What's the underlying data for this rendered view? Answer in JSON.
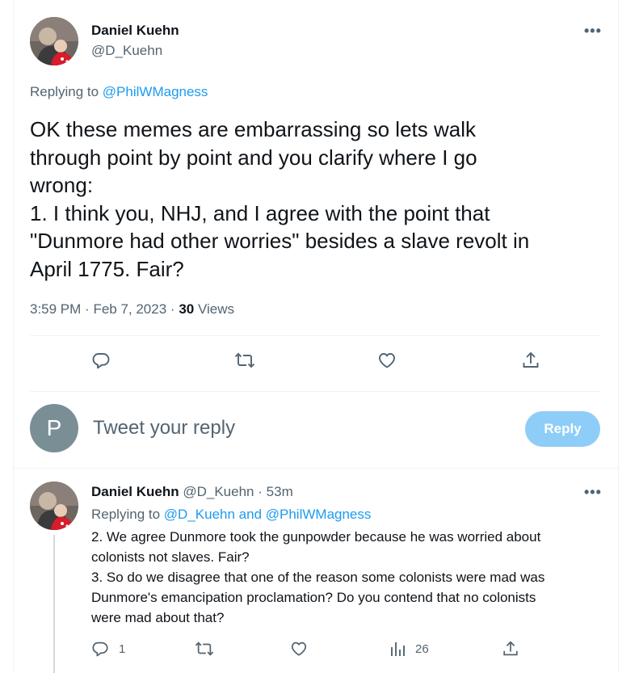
{
  "main_tweet": {
    "author_name": "Daniel Kuehn",
    "author_handle": "@D_Kuehn",
    "replying_prefix": "Replying to",
    "replying_to": "@PhilWMagness",
    "text": "OK these memes are embarrassing so lets walk\nthrough point by point and you clarify where I go\nwrong:\n1. I think you, NHJ, and I agree with the point that\n\"Dunmore had other worries\" besides a slave revolt in\nApril 1775. Fair?",
    "time": "3:59 PM",
    "date": "Feb 7, 2023",
    "views_count": "30",
    "views_label": "Views",
    "more_icon": "•••"
  },
  "reply_composer": {
    "avatar_letter": "P",
    "placeholder": "Tweet your reply",
    "button_label": "Reply"
  },
  "reply_tweet": {
    "author_name": "Daniel Kuehn",
    "author_handle": "@D_Kuehn",
    "separator": "·",
    "time_ago": "53m",
    "replying_prefix": "Replying to",
    "replying_to": "@D_Kuehn and @PhilWMagness",
    "text": "2. We agree Dunmore took the gunpowder because he was worried about\ncolonists not slaves. Fair?\n3. So do we disagree that one of the reason some colonists were mad was\nDunmore's emancipation proclamation? Do you contend that no colonists\nwere mad about that?",
    "reply_count": "1",
    "views_count": "26",
    "more_icon": "•••"
  },
  "colors": {
    "link": "#1d9bf0",
    "secondary_text": "#536471",
    "reply_button": "#8ecdf7",
    "divider": "#eff3f4"
  }
}
